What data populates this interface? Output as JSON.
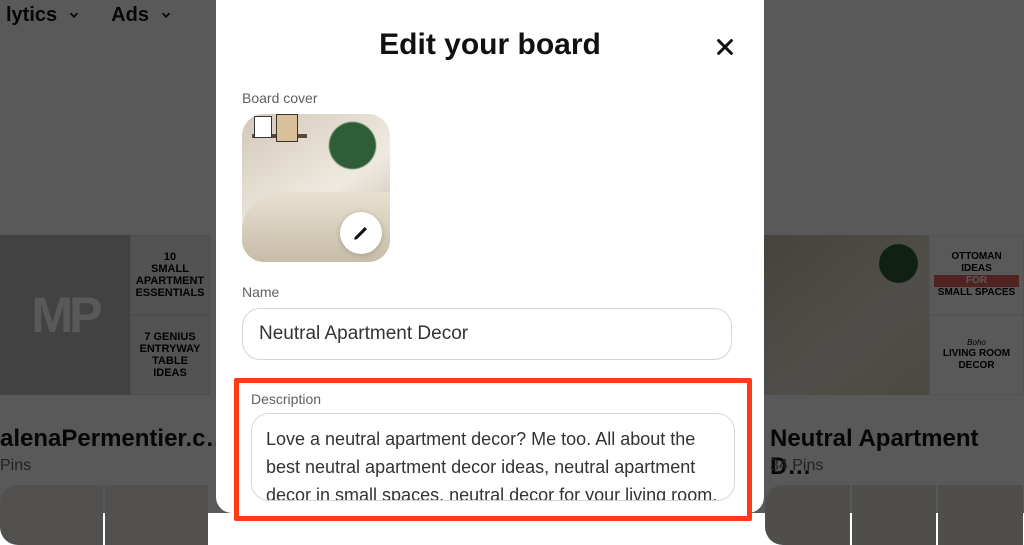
{
  "nav": {
    "analytics": "lytics",
    "ads": "Ads"
  },
  "background": {
    "left_board_title": "alenaPermentier.c…",
    "left_board_sub": "Pins",
    "left_big_letters": "MP",
    "left_tile_top_line1": "10",
    "left_tile_top_line2": "SMALL APARTMENT",
    "left_tile_top_line3": "ESSENTIALS",
    "left_tile_bottom_line1": "7 GENIUS",
    "left_tile_bottom_line2": "ENTRYWAY",
    "left_tile_bottom_line3": "TABLE",
    "left_tile_bottom_line4": "IDEAS",
    "right_board_title": "Neutral Apartment D…",
    "right_board_sub": "34 Pins",
    "right_tile_top_line1": "OTTOMAN",
    "right_tile_top_line2": "IDEAS",
    "right_tile_top_line3": "FOR",
    "right_tile_top_line4": "SMALL SPACES",
    "right_tile_bottom_line1": "Boho",
    "right_tile_bottom_line2": "LIVING ROOM",
    "right_tile_bottom_line3": "DECOR"
  },
  "modal": {
    "title": "Edit your board",
    "cover_label": "Board cover",
    "name_label": "Name",
    "name_value": "Neutral Apartment Decor",
    "desc_label": "Description",
    "desc_value": "Love a neutral apartment decor? Me too. All about the best neutral apartment decor ideas, neutral apartment decor in small spaces, neutral decor for your living room, neutral"
  }
}
